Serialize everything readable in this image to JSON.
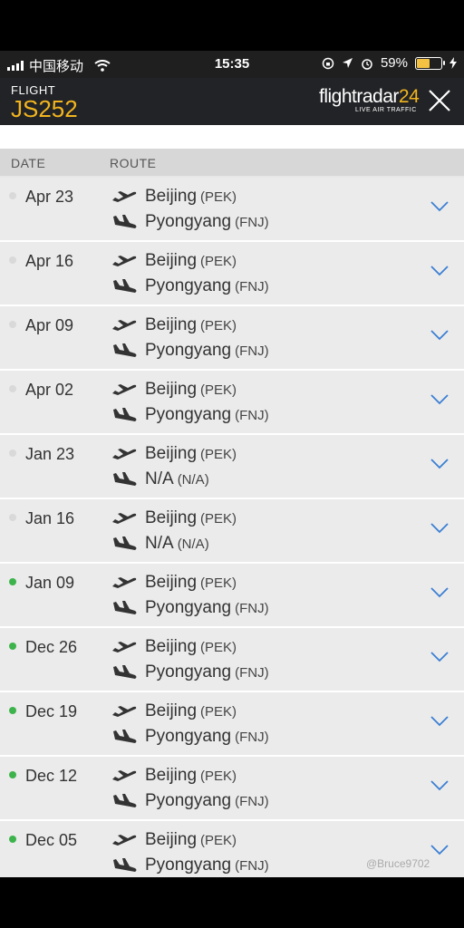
{
  "status_bar": {
    "carrier": "中国移动",
    "time": "15:35",
    "battery": "59%",
    "battery_level": 0.59,
    "icons": [
      "signal-icon",
      "wifi-icon",
      "orientation-lock-icon",
      "location-arrow-icon",
      "alarm-icon",
      "battery-icon",
      "charging-icon"
    ]
  },
  "header": {
    "label": "FLIGHT",
    "flight_number": "JS252",
    "logo_text": "flightradar",
    "logo_number": "24",
    "logo_sub": "LIVE AIR TRAFFIC",
    "close_icon": "close-icon"
  },
  "columns": {
    "date": "DATE",
    "route": "ROUTE"
  },
  "colors": {
    "accent": "#f2b51f",
    "active_dot": "#3cb44b",
    "inactive_dot": "#d9d9d9",
    "chevron": "#3b7fd4"
  },
  "rows": [
    {
      "date": "Apr 23",
      "from": "Beijing",
      "from_code": "(PEK)",
      "to": "Pyongyang",
      "to_code": "(FNJ)",
      "active": false
    },
    {
      "date": "Apr 16",
      "from": "Beijing",
      "from_code": "(PEK)",
      "to": "Pyongyang",
      "to_code": "(FNJ)",
      "active": false
    },
    {
      "date": "Apr 09",
      "from": "Beijing",
      "from_code": "(PEK)",
      "to": "Pyongyang",
      "to_code": "(FNJ)",
      "active": false
    },
    {
      "date": "Apr 02",
      "from": "Beijing",
      "from_code": "(PEK)",
      "to": "Pyongyang",
      "to_code": "(FNJ)",
      "active": false
    },
    {
      "date": "Jan 23",
      "from": "Beijing",
      "from_code": "(PEK)",
      "to": "N/A",
      "to_code": "(N/A)",
      "active": false
    },
    {
      "date": "Jan 16",
      "from": "Beijing",
      "from_code": "(PEK)",
      "to": "N/A",
      "to_code": "(N/A)",
      "active": false
    },
    {
      "date": "Jan 09",
      "from": "Beijing",
      "from_code": "(PEK)",
      "to": "Pyongyang",
      "to_code": "(FNJ)",
      "active": true
    },
    {
      "date": "Dec 26",
      "from": "Beijing",
      "from_code": "(PEK)",
      "to": "Pyongyang",
      "to_code": "(FNJ)",
      "active": true
    },
    {
      "date": "Dec 19",
      "from": "Beijing",
      "from_code": "(PEK)",
      "to": "Pyongyang",
      "to_code": "(FNJ)",
      "active": true
    },
    {
      "date": "Dec 12",
      "from": "Beijing",
      "from_code": "(PEK)",
      "to": "Pyongyang",
      "to_code": "(FNJ)",
      "active": true
    },
    {
      "date": "Dec 05",
      "from": "Beijing",
      "from_code": "(PEK)",
      "to": "Pyongyang",
      "to_code": "(FNJ)",
      "active": true
    }
  ],
  "watermark": "@Bruce9702"
}
